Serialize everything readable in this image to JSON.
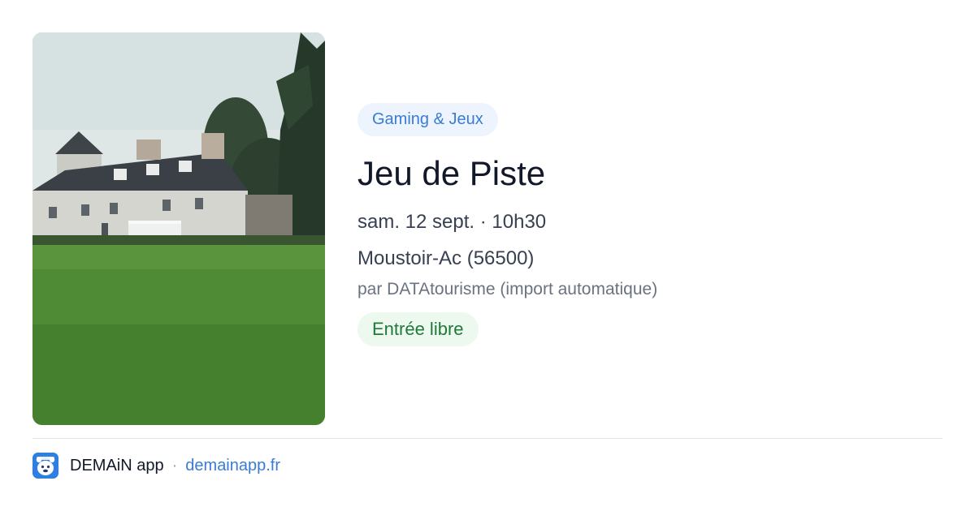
{
  "event": {
    "category": "Gaming & Jeux",
    "title": "Jeu de Piste",
    "datetime": "sam. 12 sept. · 10h30",
    "location": "Moustoir-Ac (56500)",
    "organizer": "par DATAtourisme (import automatique)",
    "price": "Entrée libre"
  },
  "footer": {
    "app_name": "DEMAiN app",
    "separator": "·",
    "site": "demainapp.fr"
  },
  "colors": {
    "category_bg": "#eef4fd",
    "category_text": "#3a7bd5",
    "price_bg": "#edf8ef",
    "price_text": "#1f7a3a",
    "link": "#3a7bd5",
    "app_icon": "#2f7fe0"
  },
  "icons": {
    "app_logo": "demain-app-logo-icon"
  }
}
